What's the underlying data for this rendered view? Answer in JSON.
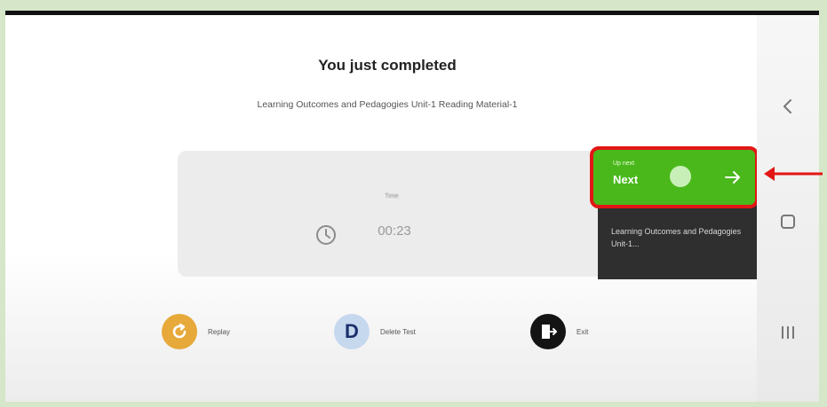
{
  "completion": {
    "title": "You just completed",
    "item_name": "Learning Outcomes and Pedagogies Unit-1 Reading Material-1"
  },
  "timer": {
    "label": "Time",
    "value": "00:23",
    "icon": "clock-icon"
  },
  "next": {
    "small_label": "Up next",
    "label": "Next",
    "icon": "arrow-right-icon",
    "description": "Learning Outcomes and Pedagogies Unit-1..."
  },
  "actions": [
    {
      "label": "Replay",
      "icon": "replay-icon"
    },
    {
      "label": "Delete Test",
      "badge": "D"
    },
    {
      "label": "Exit",
      "icon": "exit-icon"
    }
  ],
  "system_nav": {
    "back_icon": "chevron-left-icon",
    "home_icon": "square-icon",
    "recents_icon": "recents-icon"
  },
  "colors": {
    "next_button": "#4ab81b",
    "highlight_border": "#e21616",
    "replay": "#e6a93a",
    "popup_bg": "#2f2f2f"
  }
}
